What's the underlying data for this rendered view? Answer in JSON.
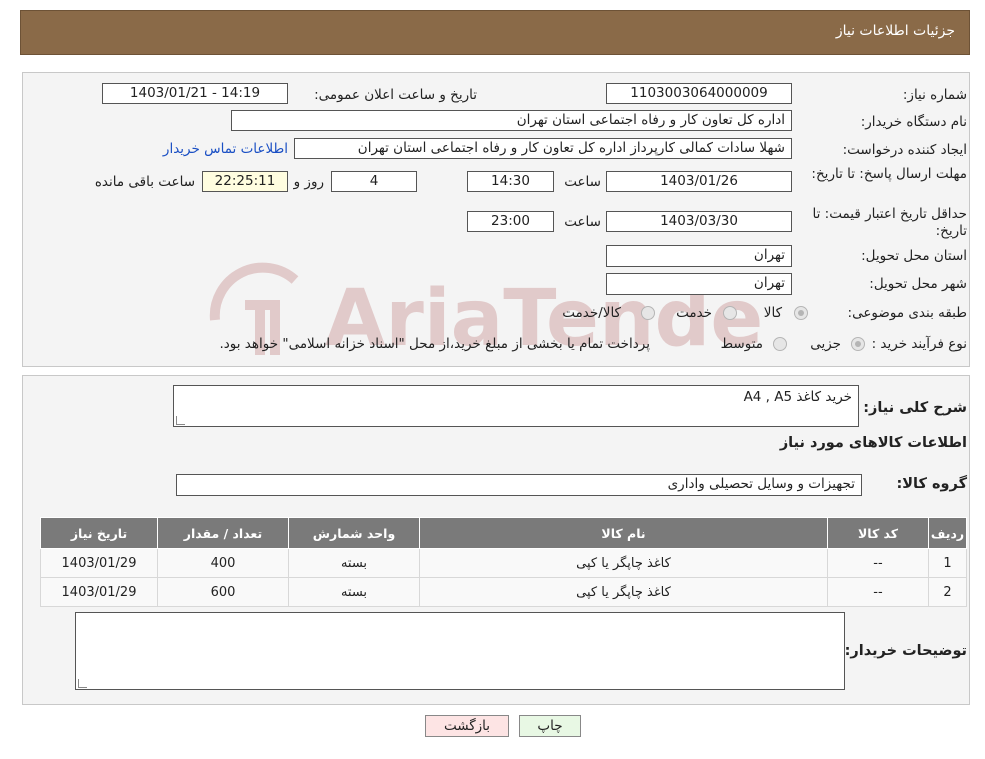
{
  "header": {
    "title": "جزئیات اطلاعات نیاز"
  },
  "fields": {
    "need_number_label": "شماره نیاز:",
    "need_number": "1103003064000009",
    "announce_label": "تاریخ و ساعت اعلان عمومی:",
    "announce_value": "1403/01/21 - 14:19",
    "buyer_org_label": "نام دستگاه خریدار:",
    "buyer_org": "اداره کل تعاون  کار و رفاه اجتماعی استان تهران",
    "creator_label": "ایجاد کننده درخواست:",
    "creator": "شهلا سادات کمالی کارپرداز اداره کل تعاون  کار و رفاه اجتماعی استان تهران",
    "contact_link": "اطلاعات تماس خریدار",
    "deadline_label": "مهلت ارسال پاسخ: تا تاریخ:",
    "deadline_date": "1403/01/26",
    "time_label": "ساعت",
    "deadline_time": "14:30",
    "days_value": "4",
    "days_label": "روز و",
    "remaining_value": "22:25:11",
    "remaining_label": "ساعت باقی مانده",
    "validity_label": "حداقل تاریخ اعتبار قیمت: تا تاریخ:",
    "validity_date": "1403/03/30",
    "validity_time": "23:00",
    "province_label": "استان محل تحویل:",
    "province": "تهران",
    "city_label": "شهر محل تحویل:",
    "city": "تهران",
    "category_label": "طبقه بندی موضوعی:",
    "category_options": [
      "کالا",
      "خدمت",
      "کالا/خدمت"
    ],
    "process_label": "نوع فرآیند خرید :",
    "process_options": [
      "جزیی",
      "متوسط"
    ],
    "process_note": "پرداخت تمام یا بخشی از مبلغ خرید،از محل \"اسناد خزانه اسلامی\" خواهد بود."
  },
  "summary": {
    "description_label": "شرح کلی نیاز:",
    "description": "خرید کاغذ A4 , A5",
    "goods_info_title": "اطلاعات کالاهای مورد نیاز",
    "goods_group_label": "گروه کالا:",
    "goods_group": "تجهیزات و وسایل تحصیلی واداری"
  },
  "table": {
    "headers": [
      "ردیف",
      "کد کالا",
      "نام کالا",
      "واحد شمارش",
      "تعداد / مقدار",
      "تاریخ نیاز"
    ],
    "rows": [
      [
        "1",
        "--",
        "کاغذ چاپگر یا کپی",
        "بسته",
        "400",
        "1403/01/29"
      ],
      [
        "2",
        "--",
        "کاغذ چاپگر یا کپی",
        "بسته",
        "600",
        "1403/01/29"
      ]
    ]
  },
  "buyer_notes_label": "توضیحات خریدار:",
  "buttons": {
    "print": "چاپ",
    "back": "بازگشت"
  },
  "watermark": "AriaTender.neT",
  "colors": {
    "header_bg": "#8a6a48",
    "table_header_bg": "#7a7a7a",
    "link": "#1a4fc4",
    "back_button_bg": "#fde4e4",
    "print_button_bg": "#e8f8e4"
  }
}
